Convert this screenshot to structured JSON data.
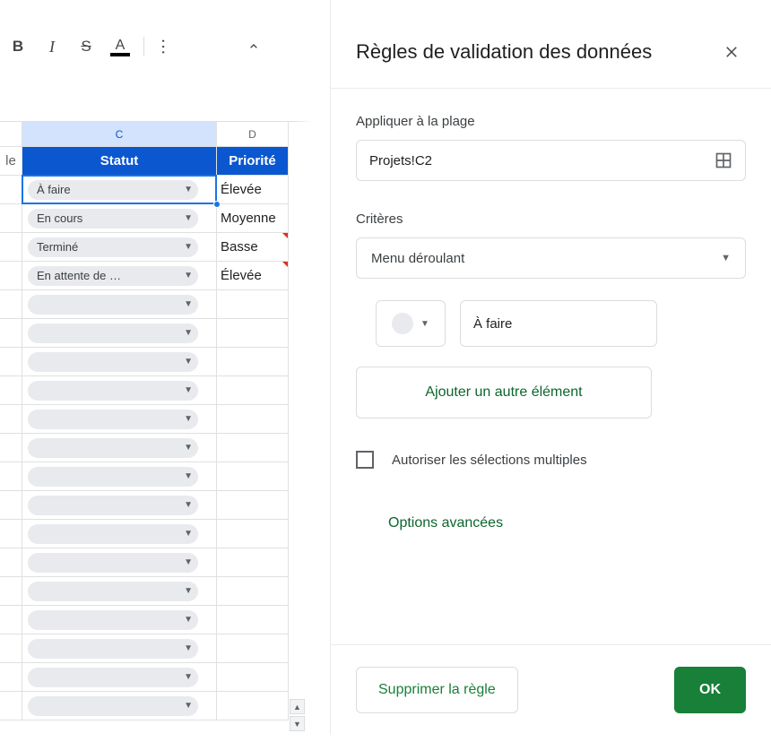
{
  "toolbar": {
    "bold": "B",
    "italic": "I",
    "strike": "S",
    "textcolor": "A",
    "more": "…"
  },
  "sheet": {
    "columns": [
      "C",
      "D"
    ],
    "activeColumn": "C",
    "headerRow": {
      "stub": "le",
      "c": "Statut",
      "d": "Priorité"
    },
    "rows": [
      {
        "c": "À faire",
        "d": "Élevée",
        "selected": true,
        "hasChip": true,
        "flag": false
      },
      {
        "c": "En cours",
        "d": "Moyenne",
        "selected": false,
        "hasChip": true,
        "flag": false
      },
      {
        "c": "Terminé",
        "d": "Basse",
        "selected": false,
        "hasChip": true,
        "flag": true
      },
      {
        "c": "En attente de …",
        "d": "Élevée",
        "selected": false,
        "hasChip": true,
        "flag": true
      },
      {
        "c": "",
        "d": "",
        "selected": false,
        "hasChip": true,
        "flag": false
      },
      {
        "c": "",
        "d": "",
        "selected": false,
        "hasChip": true,
        "flag": false
      },
      {
        "c": "",
        "d": "",
        "selected": false,
        "hasChip": true,
        "flag": false
      },
      {
        "c": "",
        "d": "",
        "selected": false,
        "hasChip": true,
        "flag": false
      },
      {
        "c": "",
        "d": "",
        "selected": false,
        "hasChip": true,
        "flag": false
      },
      {
        "c": "",
        "d": "",
        "selected": false,
        "hasChip": true,
        "flag": false
      },
      {
        "c": "",
        "d": "",
        "selected": false,
        "hasChip": true,
        "flag": false
      },
      {
        "c": "",
        "d": "",
        "selected": false,
        "hasChip": true,
        "flag": false
      },
      {
        "c": "",
        "d": "",
        "selected": false,
        "hasChip": true,
        "flag": false
      },
      {
        "c": "",
        "d": "",
        "selected": false,
        "hasChip": true,
        "flag": false
      },
      {
        "c": "",
        "d": "",
        "selected": false,
        "hasChip": true,
        "flag": false
      },
      {
        "c": "",
        "d": "",
        "selected": false,
        "hasChip": true,
        "flag": false
      },
      {
        "c": "",
        "d": "",
        "selected": false,
        "hasChip": true,
        "flag": false
      },
      {
        "c": "",
        "d": "",
        "selected": false,
        "hasChip": true,
        "flag": false
      },
      {
        "c": "",
        "d": "",
        "selected": false,
        "hasChip": true,
        "flag": false
      }
    ]
  },
  "panel": {
    "title": "Règles de validation des données",
    "applyTo": {
      "label": "Appliquer à la plage",
      "value": "Projets!C2"
    },
    "criteria": {
      "label": "Critères",
      "type": "Menu déroulant",
      "itemValue": "À faire",
      "addItem": "Ajouter un autre élément",
      "allowMultiple": "Autoriser les sélections multiples",
      "advanced": "Options avancées"
    },
    "footer": {
      "delete": "Supprimer la règle",
      "ok": "OK"
    }
  }
}
